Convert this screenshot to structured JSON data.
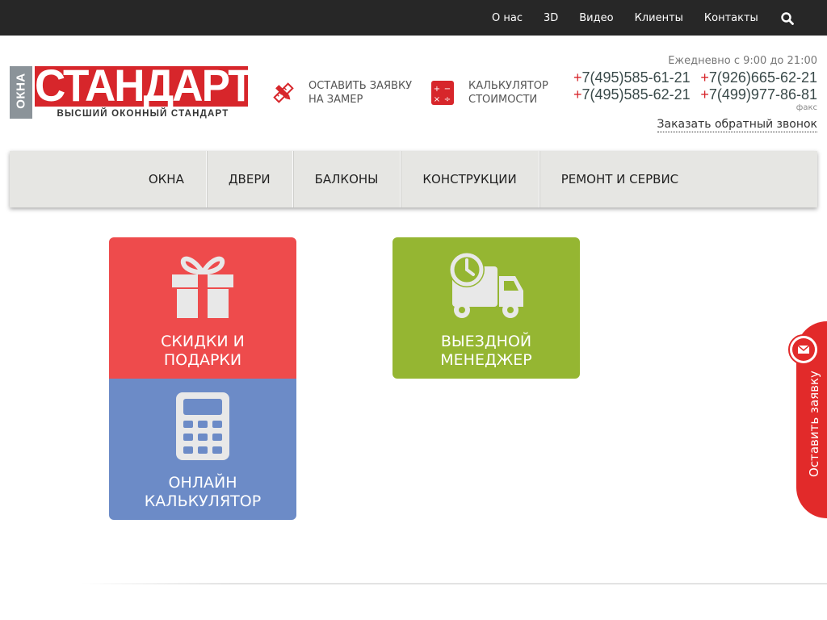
{
  "topbar": {
    "links": [
      "О нас",
      "3D",
      "Видео",
      "Клиенты",
      "Контакты"
    ],
    "search_icon": "search-icon"
  },
  "logo": {
    "side_text": "ОКНА",
    "main_text": "СТАНДАРТ",
    "tagline": "ВЫСШИЙ ОКОННЫЙ СТАНДАРТ"
  },
  "header": {
    "zamer_label_1": "ОСТАВИТЬ ЗАЯВКУ",
    "zamer_label_2": "НА ЗАМЕР",
    "calc_label_1": "КАЛЬКУЛЯТОР",
    "calc_label_2": "СТОИМОСТИ",
    "hours": "Ежедневно с 9:00 до 21:00",
    "phones": [
      [
        "7(495)585-61-21",
        "7(926)665-62-21"
      ],
      [
        "7(495)585-62-21",
        "7(499)977-86-81"
      ]
    ],
    "fax": "факс",
    "callback": "Заказать обратный звонок"
  },
  "mainnav": [
    "Окна",
    "Двери",
    "Балконы",
    "Конструкции",
    "Ремонт и сервис"
  ],
  "tiles": {
    "sale_1": "СКИДКИ И",
    "sale_2": "ПОДАРКИ",
    "manager_1": "ВЫЕЗДНОЙ",
    "manager_2": "МЕНЕДЖЕР",
    "calc_1": "ОНЛАЙН",
    "calc_2": "КАЛЬКУЛЯТОР"
  },
  "side_tab": {
    "label": "Оставить заявку"
  },
  "colors": {
    "brand_red": "#d7262b",
    "sale_tile": "#ee4b4c",
    "manager_tile": "#95b632",
    "calc_tile": "#6c8bc7",
    "topbar": "#272727"
  }
}
